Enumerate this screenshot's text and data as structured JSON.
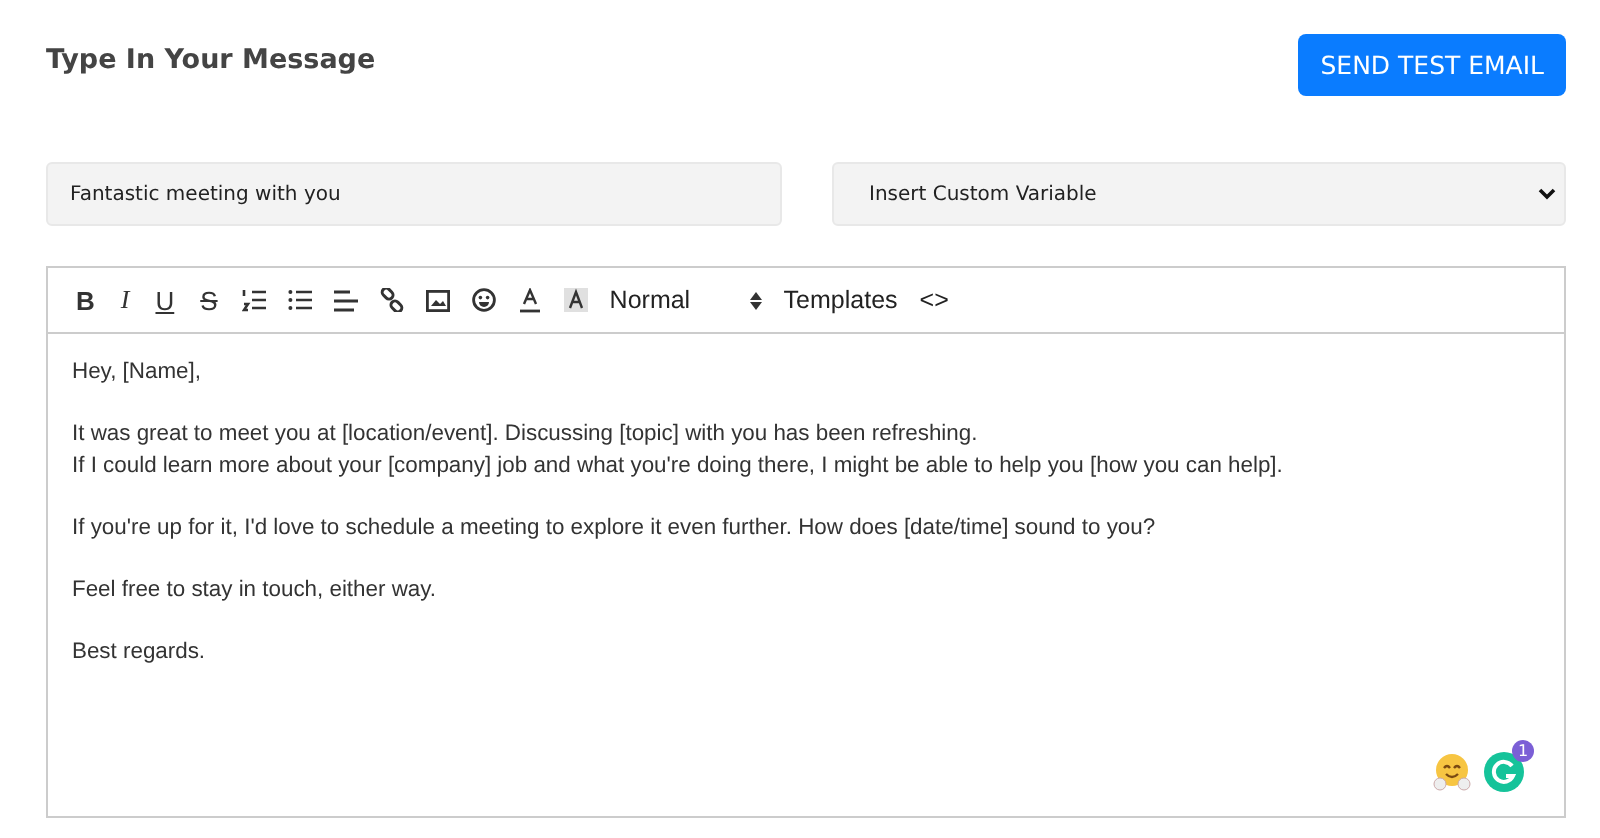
{
  "title": "Type In Your Message",
  "send_button": "SEND TEST EMAIL",
  "subject_field": {
    "value": "Fantastic meeting with you"
  },
  "variable_select": {
    "value": "Insert Custom Variable"
  },
  "toolbar": [
    {
      "kind": "glyph",
      "label": "B"
    },
    {
      "kind": "glyph",
      "label": "I"
    },
    {
      "kind": "glyph",
      "label": "U"
    },
    {
      "kind": "glyph",
      "label": "S"
    },
    {
      "kind": "icon"
    },
    {
      "kind": "icon"
    },
    {
      "kind": "icon"
    },
    {
      "kind": "icon"
    },
    {
      "kind": "icon"
    },
    {
      "kind": "icon"
    },
    {
      "kind": "icon"
    },
    {
      "kind": "icon"
    },
    {
      "kind": "dropdown",
      "label": "Normal"
    },
    {
      "kind": "text",
      "label": "Templates"
    },
    {
      "kind": "text",
      "label": "<>"
    }
  ],
  "paragraphs": [
    [
      "Hey, [Name],"
    ],
    [
      "It was great to meet you at [location/event]. Discussing [topic] with you has been refreshing.",
      "If I could learn more about your [company] job and what you're doing there, I might be able to help you [how you can help]."
    ],
    [
      "If you're up for it, I'd love to schedule a meeting to explore it even further. How does [date/time] sound to you?"
    ],
    [
      "Feel free to stay in touch, either way."
    ],
    [
      "Best regards."
    ]
  ],
  "grammarly_badge": "1"
}
